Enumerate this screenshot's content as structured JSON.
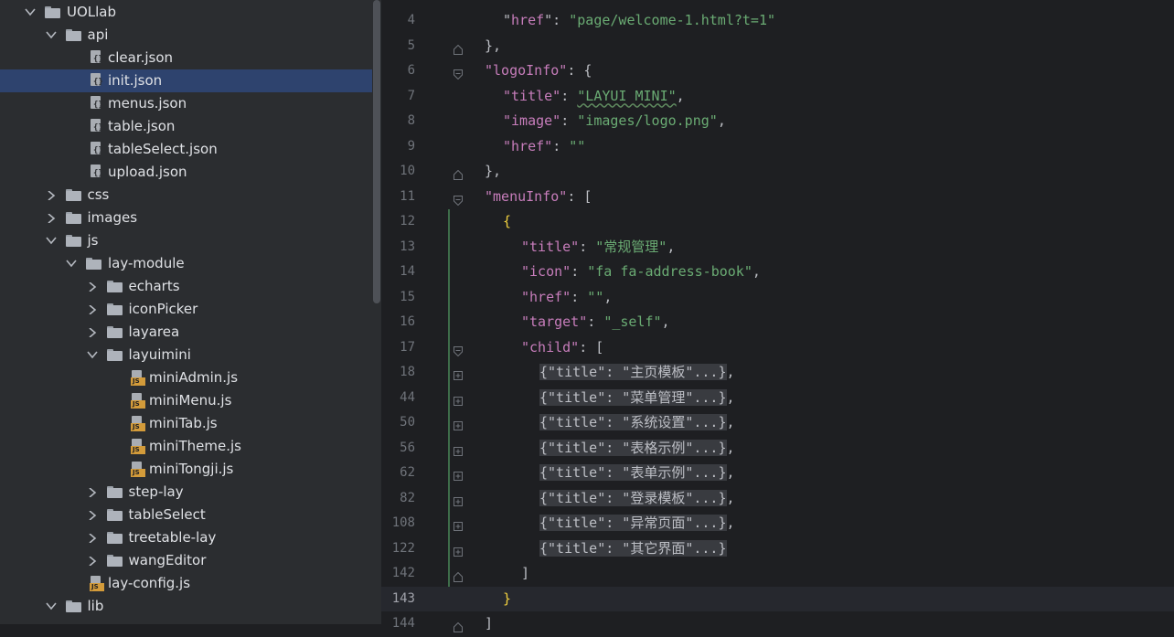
{
  "project_tree": {
    "items": [
      {
        "label": "UOLlab",
        "type": "folder",
        "expanded": true,
        "depth": 0
      },
      {
        "label": "api",
        "type": "folder",
        "expanded": true,
        "depth": 1
      },
      {
        "label": "clear.json",
        "type": "json",
        "depth": 2
      },
      {
        "label": "init.json",
        "type": "json",
        "depth": 2,
        "selected": true
      },
      {
        "label": "menus.json",
        "type": "json",
        "depth": 2
      },
      {
        "label": "table.json",
        "type": "json",
        "depth": 2
      },
      {
        "label": "tableSelect.json",
        "type": "json",
        "depth": 2
      },
      {
        "label": "upload.json",
        "type": "json",
        "depth": 2
      },
      {
        "label": "css",
        "type": "folder",
        "expanded": false,
        "depth": 1
      },
      {
        "label": "images",
        "type": "folder",
        "expanded": false,
        "depth": 1
      },
      {
        "label": "js",
        "type": "folder",
        "expanded": true,
        "depth": 1
      },
      {
        "label": "lay-module",
        "type": "folder",
        "expanded": true,
        "depth": 2
      },
      {
        "label": "echarts",
        "type": "folder",
        "expanded": false,
        "depth": 3
      },
      {
        "label": "iconPicker",
        "type": "folder",
        "expanded": false,
        "depth": 3
      },
      {
        "label": "layarea",
        "type": "folder",
        "expanded": false,
        "depth": 3
      },
      {
        "label": "layuimini",
        "type": "folder",
        "expanded": true,
        "depth": 3
      },
      {
        "label": "miniAdmin.js",
        "type": "js",
        "depth": 4
      },
      {
        "label": "miniMenu.js",
        "type": "js",
        "depth": 4
      },
      {
        "label": "miniTab.js",
        "type": "js",
        "depth": 4
      },
      {
        "label": "miniTheme.js",
        "type": "js",
        "depth": 4
      },
      {
        "label": "miniTongji.js",
        "type": "js",
        "depth": 4
      },
      {
        "label": "step-lay",
        "type": "folder",
        "expanded": false,
        "depth": 3
      },
      {
        "label": "tableSelect",
        "type": "folder",
        "expanded": false,
        "depth": 3
      },
      {
        "label": "treetable-lay",
        "type": "folder",
        "expanded": false,
        "depth": 3
      },
      {
        "label": "wangEditor",
        "type": "folder",
        "expanded": false,
        "depth": 3
      },
      {
        "label": "lay-config.js",
        "type": "js",
        "depth": 2
      },
      {
        "label": "lib",
        "type": "folder",
        "expanded": true,
        "depth": 1
      }
    ],
    "icon_names": {
      "folder": "folder-icon",
      "json": "json-file-icon",
      "js": "js-file-icon",
      "expanded": "chevron-down-icon",
      "collapsed": "chevron-right-icon"
    }
  },
  "editor": {
    "current_line": "143",
    "lines": [
      {
        "n": "4",
        "indent": 1,
        "fold": "none",
        "tokens": [
          [
            "p",
            "\""
          ],
          [
            "k",
            "href"
          ],
          [
            "p",
            "\": "
          ],
          [
            "s",
            "\"page/welcome-1.html?t=1\""
          ]
        ]
      },
      {
        "n": "5",
        "indent": 0,
        "fold": "end",
        "tokens": [
          [
            "p",
            "},"
          ]
        ]
      },
      {
        "n": "6",
        "indent": 0,
        "fold": "start",
        "tokens": [
          [
            "k",
            "\"logoInfo\""
          ],
          [
            "p",
            ": {"
          ]
        ]
      },
      {
        "n": "7",
        "indent": 1,
        "fold": "none",
        "tokens": [
          [
            "k",
            "\"title\""
          ],
          [
            "p",
            ": "
          ],
          [
            "s",
            "\"LAYUI MINI\""
          ],
          [
            "p",
            ","
          ]
        ]
      },
      {
        "n": "8",
        "indent": 1,
        "fold": "none",
        "tokens": [
          [
            "k",
            "\"image\""
          ],
          [
            "p",
            ": "
          ],
          [
            "s",
            "\"images/logo.png\""
          ],
          [
            "p",
            ","
          ]
        ]
      },
      {
        "n": "9",
        "indent": 1,
        "fold": "none",
        "tokens": [
          [
            "k",
            "\"href\""
          ],
          [
            "p",
            ": "
          ],
          [
            "s",
            "\"\""
          ]
        ]
      },
      {
        "n": "10",
        "indent": 0,
        "fold": "end",
        "tokens": [
          [
            "p",
            "},"
          ]
        ]
      },
      {
        "n": "11",
        "indent": 0,
        "fold": "start",
        "tokens": [
          [
            "k",
            "\"menuInfo\""
          ],
          [
            "p",
            ": ["
          ]
        ]
      },
      {
        "n": "12",
        "indent": 1,
        "fold": "none",
        "tokens": [
          [
            "y",
            "{"
          ]
        ]
      },
      {
        "n": "13",
        "indent": 2,
        "fold": "none",
        "tokens": [
          [
            "k",
            "\"title\""
          ],
          [
            "p",
            ": "
          ],
          [
            "s",
            "\"常规管理\""
          ],
          [
            "p",
            ","
          ]
        ]
      },
      {
        "n": "14",
        "indent": 2,
        "fold": "none",
        "tokens": [
          [
            "k",
            "\"icon\""
          ],
          [
            "p",
            ": "
          ],
          [
            "s",
            "\"fa fa-address-book\""
          ],
          [
            "p",
            ","
          ]
        ]
      },
      {
        "n": "15",
        "indent": 2,
        "fold": "none",
        "tokens": [
          [
            "k",
            "\"href\""
          ],
          [
            "p",
            ": "
          ],
          [
            "s",
            "\"\""
          ],
          [
            "p",
            ","
          ]
        ]
      },
      {
        "n": "16",
        "indent": 2,
        "fold": "none",
        "tokens": [
          [
            "k",
            "\"target\""
          ],
          [
            "p",
            ": "
          ],
          [
            "s",
            "\"_self\""
          ],
          [
            "p",
            ","
          ]
        ]
      },
      {
        "n": "17",
        "indent": 2,
        "fold": "start",
        "tokens": [
          [
            "k",
            "\"child\""
          ],
          [
            "p",
            ": ["
          ]
        ]
      },
      {
        "n": "18",
        "indent": 3,
        "fold": "collapsed",
        "tokens": [
          [
            "c",
            "{\"title\": \"主页模板\"...}"
          ],
          [
            "p",
            ","
          ]
        ]
      },
      {
        "n": "44",
        "indent": 3,
        "fold": "collapsed",
        "tokens": [
          [
            "c",
            "{\"title\": \"菜单管理\"...}"
          ],
          [
            "p",
            ","
          ]
        ]
      },
      {
        "n": "50",
        "indent": 3,
        "fold": "collapsed",
        "tokens": [
          [
            "c",
            "{\"title\": \"系统设置\"...}"
          ],
          [
            "p",
            ","
          ]
        ]
      },
      {
        "n": "56",
        "indent": 3,
        "fold": "collapsed",
        "tokens": [
          [
            "c",
            "{\"title\": \"表格示例\"...}"
          ],
          [
            "p",
            ","
          ]
        ]
      },
      {
        "n": "62",
        "indent": 3,
        "fold": "collapsed",
        "tokens": [
          [
            "c",
            "{\"title\": \"表单示例\"...}"
          ],
          [
            "p",
            ","
          ]
        ]
      },
      {
        "n": "82",
        "indent": 3,
        "fold": "collapsed",
        "tokens": [
          [
            "c",
            "{\"title\": \"登录模板\"...}"
          ],
          [
            "p",
            ","
          ]
        ]
      },
      {
        "n": "108",
        "indent": 3,
        "fold": "collapsed",
        "tokens": [
          [
            "c",
            "{\"title\": \"异常页面\"...}"
          ],
          [
            "p",
            ","
          ]
        ]
      },
      {
        "n": "122",
        "indent": 3,
        "fold": "collapsed",
        "tokens": [
          [
            "c",
            "{\"title\": \"其它界面\"...}"
          ]
        ]
      },
      {
        "n": "142",
        "indent": 2,
        "fold": "end",
        "tokens": [
          [
            "p",
            "]"
          ]
        ]
      },
      {
        "n": "143",
        "indent": 1,
        "fold": "none",
        "tokens": [
          [
            "y",
            "}"
          ]
        ]
      },
      {
        "n": "144",
        "indent": 0,
        "fold": "end",
        "tokens": [
          [
            "p",
            "]"
          ]
        ]
      }
    ]
  }
}
